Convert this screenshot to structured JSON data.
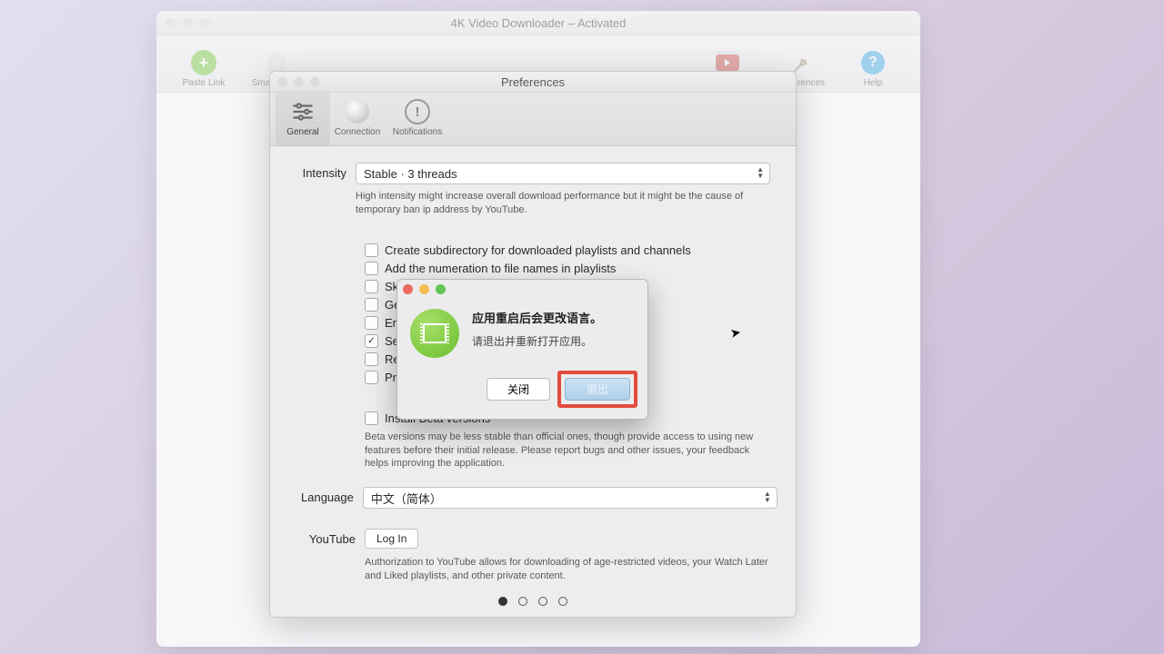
{
  "main": {
    "title": "4K Video Downloader – Activated",
    "toolbar": {
      "paste": "Paste Link",
      "smart": "Smart Mode",
      "subs": "Subscriptions",
      "prefs": "Preferences",
      "help": "Help"
    }
  },
  "prefs": {
    "title": "Preferences",
    "tabs": {
      "general": "General",
      "connection": "Connection",
      "notifications": "Notifications"
    },
    "intensity": {
      "label": "Intensity",
      "value": "Stable · 3 threads",
      "hint": "High intensity might increase overall download performance but it might be the cause of temporary ban ip address by YouTube."
    },
    "checks": {
      "c0": "Create subdirectory for downloaded playlists and channels",
      "c1": "Add the numeration to file names in playlists",
      "c2": "Skip",
      "c3": "Gene",
      "c4": "Emb",
      "c5": "Sear",
      "c6": "Rem",
      "c7": "Prev"
    },
    "beta": {
      "label": "Install Beta versions",
      "hint": "Beta versions may be less stable than official ones, though provide access to using new features before their initial release. Please report bugs and other issues, your feedback helps improving the application."
    },
    "language": {
      "label": "Language",
      "value": "中文（简体）"
    },
    "youtube": {
      "label": "YouTube",
      "button": "Log In",
      "hint": "Authorization to YouTube allows for downloading of age-restricted videos, your Watch Later and Liked playlists, and other private content."
    }
  },
  "modal": {
    "title": "应用重启后会更改语言。",
    "subtitle": "请退出并重新打开应用。",
    "close": "关闭",
    "quit": "退出"
  }
}
